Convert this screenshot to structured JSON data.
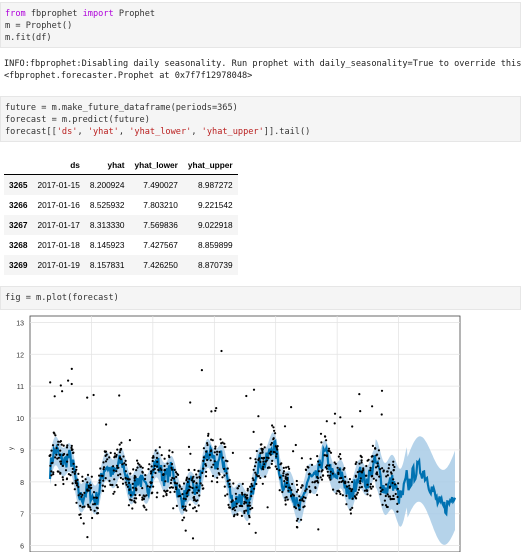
{
  "cell1": {
    "lines": [
      {
        "parts": [
          {
            "t": "from",
            "c": "kw"
          },
          {
            "t": " fbprophet ",
            "c": ""
          },
          {
            "t": "import",
            "c": "kw"
          },
          {
            "t": " Prophet",
            "c": ""
          }
        ]
      },
      {
        "parts": [
          {
            "t": "m = Prophet()",
            "c": ""
          }
        ]
      },
      {
        "parts": [
          {
            "t": "m.fit(df)",
            "c": ""
          }
        ]
      }
    ]
  },
  "output1": {
    "line1": "INFO:fbprophet:Disabling daily seasonality. Run prophet with daily_seasonality=True to override this.",
    "line2": "<fbprophet.forecaster.Prophet at 0x7f7f12978048>"
  },
  "cell2": {
    "lines": [
      {
        "parts": [
          {
            "t": "future = m.make_future_dataframe(periods=365)",
            "c": ""
          }
        ]
      },
      {
        "parts": [
          {
            "t": "forecast = m.predict(future)",
            "c": ""
          }
        ]
      },
      {
        "parts": [
          {
            "t": "forecast[[",
            "c": ""
          },
          {
            "t": "'ds'",
            "c": "str"
          },
          {
            "t": ", ",
            "c": ""
          },
          {
            "t": "'yhat'",
            "c": "str"
          },
          {
            "t": ", ",
            "c": ""
          },
          {
            "t": "'yhat_lower'",
            "c": "str"
          },
          {
            "t": ", ",
            "c": ""
          },
          {
            "t": "'yhat_upper'",
            "c": "str"
          },
          {
            "t": "]].tail()",
            "c": ""
          }
        ]
      }
    ]
  },
  "table": {
    "columns": [
      "",
      "ds",
      "yhat",
      "yhat_lower",
      "yhat_upper"
    ],
    "rows": [
      [
        "3265",
        "2017-01-15",
        "8.200924",
        "7.490027",
        "8.987272"
      ],
      [
        "3266",
        "2017-01-16",
        "8.525932",
        "7.803210",
        "9.221542"
      ],
      [
        "3267",
        "2017-01-17",
        "8.313330",
        "7.569836",
        "9.022918"
      ],
      [
        "3268",
        "2017-01-18",
        "8.145923",
        "7.427567",
        "8.859899"
      ],
      [
        "3269",
        "2017-01-19",
        "8.157831",
        "7.426250",
        "8.870739"
      ]
    ]
  },
  "cell3": {
    "lines": [
      {
        "parts": [
          {
            "t": "fig = m.plot(forecast)",
            "c": ""
          }
        ]
      }
    ]
  },
  "chart_data": {
    "type": "line",
    "ylabel": "y",
    "ylim": [
      5.8,
      13.2
    ],
    "yticks": [
      "6",
      "7",
      "8",
      "9",
      "10",
      "11",
      "12",
      "13"
    ],
    "grid": true,
    "colors": {
      "forecast": "#0072B2",
      "interval": "#a8cbe6",
      "observed": "#000000"
    },
    "n_points": 3270,
    "series": [
      {
        "values": "yhat forecast with seasonal cycles ~7.5 to 9.3"
      },
      {
        "values": "observed points scattered with outliers up to 12.8"
      }
    ]
  }
}
